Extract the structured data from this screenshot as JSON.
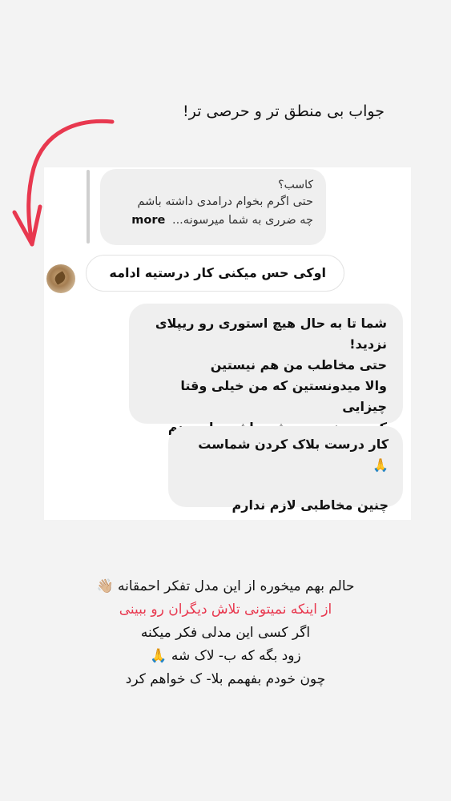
{
  "caption_top": "جواب بی منطق تر و حرصی تر!",
  "chat": {
    "reply": {
      "title": "کاسب؟",
      "line1": "حتی اگرم بخوام درامدی داشته باشم",
      "line2": "چه ضرری به شما میرسونه...",
      "more": "more"
    },
    "incoming": "اوکی حس میکنی کار درستیه ادامه بده",
    "outgoing1": {
      "line1": "شما تا به حال هیچ استوری رو ریپلای",
      "line2": "نزدید!",
      "line3": "حتی مخاطب من هم نیستین",
      "line4": "والا میدونستین که من خیلی وقتا چیزایی",
      "line5": "که میدونم بی چشم داشت یاد میدم"
    },
    "outgoing2": {
      "line1": "کار درست بلاک کردن شماست",
      "emoji": "🙏",
      "line2": "چنین مخاطبی لازم ندارم"
    }
  },
  "bottom": {
    "line1": "حالم بهم میخوره از این مدل تفکر احمقانه",
    "line1_emoji": "👋🏼",
    "line2": "از اینکه نمیتونی تلاش دیگران رو ببینی",
    "line3": "اگر کسی این مدلی فکر میکنه",
    "line4": "زود بگه که ب- لاک شه",
    "line4_emoji": "🙏",
    "line5": "چون خودم بفهمم بلا- ک خواهم کرد"
  },
  "colors": {
    "arrow": "#e8384f",
    "highlight": "#e8384f",
    "outgoing_bubble": "#efefef",
    "background": "#f3f3f3"
  }
}
